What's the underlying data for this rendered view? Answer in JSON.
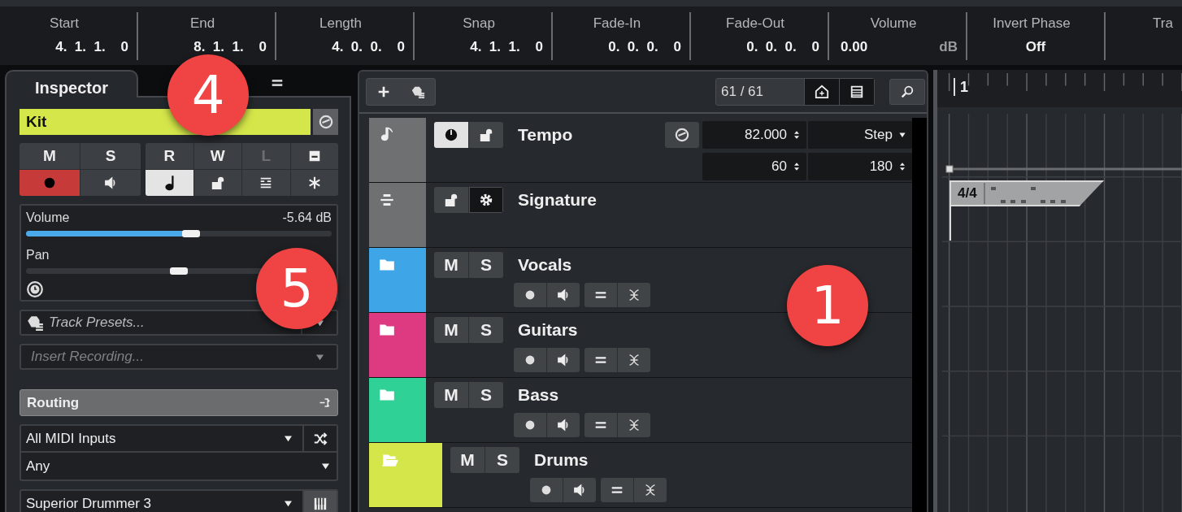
{
  "info_line": [
    {
      "label": "Start",
      "value": "4.  1.  1.    0"
    },
    {
      "label": "End",
      "value": "8.  1.  1.    0"
    },
    {
      "label": "Length",
      "value": "4.  0.  0.    0"
    },
    {
      "label": "Snap",
      "value": "4.  1.  1.    0"
    },
    {
      "label": "Fade-In",
      "value": "0.  0.  0.    0"
    },
    {
      "label": "Fade-Out",
      "value": "0.  0.  0.    0"
    },
    {
      "label": "Volume",
      "value": "0.00",
      "unit": "dB"
    },
    {
      "label": "Invert Phase",
      "value": "Off"
    },
    {
      "label": "Tra"
    }
  ],
  "inspector": {
    "tab": "Inspector",
    "track_name": "Kit",
    "color": "#d4e64a",
    "mute": "M",
    "solo": "S",
    "read": "R",
    "write": "W",
    "record_enable": {
      "on": true
    },
    "musical_mode": {
      "on": true
    },
    "lanes": {
      "label": "L",
      "disabled": true
    },
    "volume": {
      "label": "Volume",
      "reading": "-5.64 dB",
      "level": 0.57
    },
    "pan": {
      "label": "Pan",
      "level": 0.5
    },
    "track_presets": {
      "placeholder": "Track Presets..."
    },
    "insert_recording": {
      "placeholder": "Insert Recording...",
      "disabled": true
    },
    "routing": {
      "title": "Routing"
    },
    "midi_input": "All MIDI Inputs",
    "channel": "Any",
    "output": "Superior Drummer 3"
  },
  "track_list": {
    "count": "61 / 61",
    "tracks": [
      {
        "kind": "tempo",
        "name": "Tempo",
        "color": "#6f7072",
        "active": true,
        "tempo": "82.000",
        "mode": "Step",
        "min": "60",
        "max": "180"
      },
      {
        "kind": "signature",
        "name": "Signature",
        "color": "#6f7072"
      },
      {
        "kind": "folder",
        "name": "Vocals",
        "color": "#3ea6e6",
        "expanded": false,
        "mute": "M",
        "solo": "S"
      },
      {
        "kind": "folder",
        "name": "Guitars",
        "color": "#dd3a82",
        "expanded": false,
        "mute": "M",
        "solo": "S"
      },
      {
        "kind": "folder",
        "name": "Bass",
        "color": "#2fd196",
        "expanded": false,
        "mute": "M",
        "solo": "S"
      },
      {
        "kind": "folder",
        "name": "Drums",
        "color": "#d4e64a",
        "expanded": true,
        "mute": "M",
        "solo": "S"
      }
    ]
  },
  "ruler": {
    "bar": "1"
  },
  "signature_event": {
    "label": "4/4"
  },
  "callouts": [
    {
      "number": "4"
    },
    {
      "number": "5"
    },
    {
      "number": "1"
    }
  ]
}
